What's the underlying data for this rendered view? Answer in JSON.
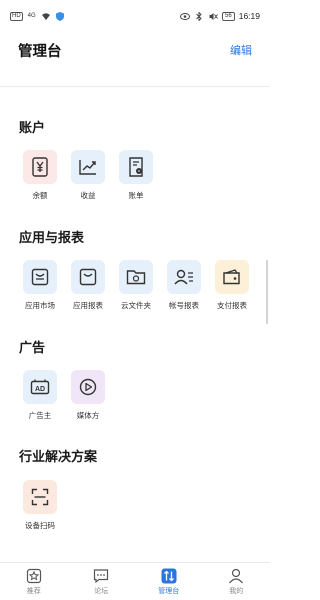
{
  "status_bar": {
    "network": "HD",
    "signal": "4G",
    "battery": "56",
    "time": "16:19"
  },
  "header": {
    "title": "管理台",
    "edit_label": "编辑"
  },
  "sections": [
    {
      "title": "账户",
      "items": [
        {
          "label": "余额",
          "icon": "balance-icon"
        },
        {
          "label": "收益",
          "icon": "earnings-icon"
        },
        {
          "label": "账单",
          "icon": "bill-icon"
        }
      ]
    },
    {
      "title": "应用与报表",
      "items": [
        {
          "label": "应用市场",
          "icon": "app-market-icon"
        },
        {
          "label": "应用报表",
          "icon": "app-report-icon"
        },
        {
          "label": "云文件夹",
          "icon": "cloud-folder-icon"
        },
        {
          "label": "帐号报表",
          "icon": "account-report-icon"
        },
        {
          "label": "支付报表",
          "icon": "payment-report-icon"
        }
      ]
    },
    {
      "title": "广告",
      "items": [
        {
          "label": "广告主",
          "icon": "advertiser-icon"
        },
        {
          "label": "媒体方",
          "icon": "media-icon"
        }
      ]
    },
    {
      "title": "行业解决方案",
      "items": [
        {
          "label": "设备扫码",
          "icon": "device-scan-icon"
        }
      ]
    }
  ],
  "tab_bar": {
    "items": [
      {
        "label": "推荐",
        "icon": "star-icon",
        "active": false
      },
      {
        "label": "论坛",
        "icon": "chat-icon",
        "active": false
      },
      {
        "label": "管理台",
        "icon": "sort-icon",
        "active": true
      },
      {
        "label": "我的",
        "icon": "person-icon",
        "active": false
      }
    ]
  },
  "colors": {
    "accent": "#2b76d8",
    "pink_tile": "#fde8e8",
    "blue_tile": "#e6f0fb",
    "purple_tile": "#f0e6f7",
    "peach_tile": "#fbe9df",
    "yellow_tile": "#fdf0d8"
  }
}
